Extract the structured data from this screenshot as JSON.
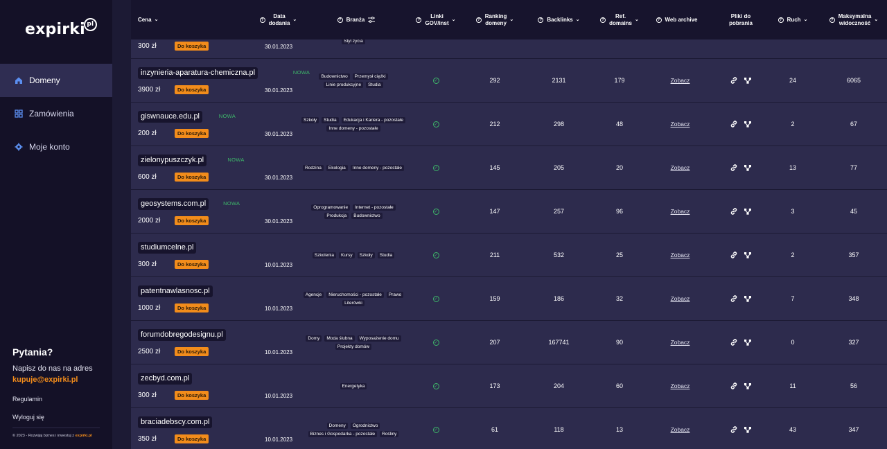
{
  "brand": {
    "name": "expirki",
    "badge": "pl"
  },
  "nav": [
    {
      "label": "Domeny",
      "icon": "home-icon",
      "active": true
    },
    {
      "label": "Zamówienia",
      "icon": "grid-icon",
      "active": false
    },
    {
      "label": "Moje konto",
      "icon": "gear-icon",
      "active": false
    }
  ],
  "help": {
    "title": "Pytania?",
    "text": "Napisz do nas na adres",
    "email": "kupuje@expirki.pl"
  },
  "links": {
    "regulamin": "Regulamin",
    "logout": "Wyloguj się"
  },
  "copyright": {
    "text": "© 2023 - Rozwijaj biznes i inwestuj z",
    "brand": "expirki.pl"
  },
  "table": {
    "headers": {
      "price": "Cena",
      "date_l1": "Data",
      "date_l2": "dodania",
      "industry": "Branża",
      "links_l1": "Linki",
      "links_l2": "GOV/inst",
      "rank_l1": "Ranking",
      "rank_l2": "domeny",
      "backlinks": "Backlinks",
      "ref_l1": "Ref.",
      "ref_l2": "domains",
      "archive": "Web archive",
      "files_l1": "Pliki do",
      "files_l2": "pobrania",
      "traffic": "Ruch",
      "vis_l1": "Maksymalna",
      "vis_l2": "widoczność"
    },
    "cart_label": "Do koszyka",
    "new_label": "NOWA",
    "archive_link": "Zobacz",
    "partial_row": {
      "price": "300 zł",
      "date": "30.01.2023",
      "tag": "Styl życia"
    },
    "rows": [
      {
        "domain": "inzynieria-aparatura-chemiczna.pl",
        "is_new": true,
        "price": "3900 zł",
        "date": "30.01.2023",
        "tags": [
          "Budownictwo",
          "Przemysł ciężki",
          "Linie produkcyjne",
          "Studia"
        ],
        "rank": "292",
        "backlinks": "2131",
        "ref": "179",
        "traffic": "24",
        "visibility": "6065"
      },
      {
        "domain": "giswnauce.edu.pl",
        "is_new": true,
        "price": "200 zł",
        "date": "30.01.2023",
        "tags": [
          "Szkoły",
          "Studia",
          "Edukacja i Kariera - pozostałe",
          "Inne domeny - pozostałe"
        ],
        "rank": "212",
        "backlinks": "298",
        "ref": "48",
        "traffic": "2",
        "visibility": "67"
      },
      {
        "domain": "zielonypuszczyk.pl",
        "is_new": true,
        "price": "600 zł",
        "date": "30.01.2023",
        "tags": [
          "Rodzina",
          "Ekologia",
          "Inne domeny - pozostałe"
        ],
        "rank": "145",
        "backlinks": "205",
        "ref": "20",
        "traffic": "13",
        "visibility": "77"
      },
      {
        "domain": "geosystems.com.pl",
        "is_new": true,
        "price": "2000 zł",
        "date": "30.01.2023",
        "tags": [
          "Oprogramowanie",
          "Internet - pozostałe",
          "Produkcja",
          "Budownictwo"
        ],
        "rank": "147",
        "backlinks": "257",
        "ref": "96",
        "traffic": "3",
        "visibility": "45"
      },
      {
        "domain": "studiumcelne.pl",
        "is_new": false,
        "price": "300 zł",
        "date": "10.01.2023",
        "tags": [
          "Szkolenia",
          "Kursy",
          "Szkoły",
          "Studia"
        ],
        "rank": "211",
        "backlinks": "532",
        "ref": "25",
        "traffic": "2",
        "visibility": "357"
      },
      {
        "domain": "patentnawlasnosc.pl",
        "is_new": false,
        "price": "1000 zł",
        "date": "10.01.2023",
        "tags": [
          "Agencje",
          "Nieruchomości - pozostałe",
          "Prawo",
          "Literówki"
        ],
        "rank": "159",
        "backlinks": "186",
        "ref": "32",
        "traffic": "7",
        "visibility": "348"
      },
      {
        "domain": "forumdobregodesignu.pl",
        "is_new": false,
        "price": "2500 zł",
        "date": "10.01.2023",
        "tags": [
          "Domy",
          "Moda ślubna",
          "Wyposażenie domu",
          "Projekty domów"
        ],
        "rank": "207",
        "backlinks": "167741",
        "ref": "90",
        "traffic": "0",
        "visibility": "327"
      },
      {
        "domain": "zecbyd.com.pl",
        "is_new": false,
        "price": "300 zł",
        "date": "10.01.2023",
        "tags": [
          "Energetyka"
        ],
        "rank": "173",
        "backlinks": "204",
        "ref": "60",
        "traffic": "11",
        "visibility": "56"
      },
      {
        "domain": "braciadebscy.com.pl",
        "is_new": false,
        "price": "350 zł",
        "date": "10.01.2023",
        "tags": [
          "Domeny",
          "Ogrodnictwo",
          "Biznes i Gospodarka - pozostałe",
          "Rośliny"
        ],
        "rank": "61",
        "backlinks": "118",
        "ref": "13",
        "traffic": "43",
        "visibility": "347"
      }
    ]
  }
}
